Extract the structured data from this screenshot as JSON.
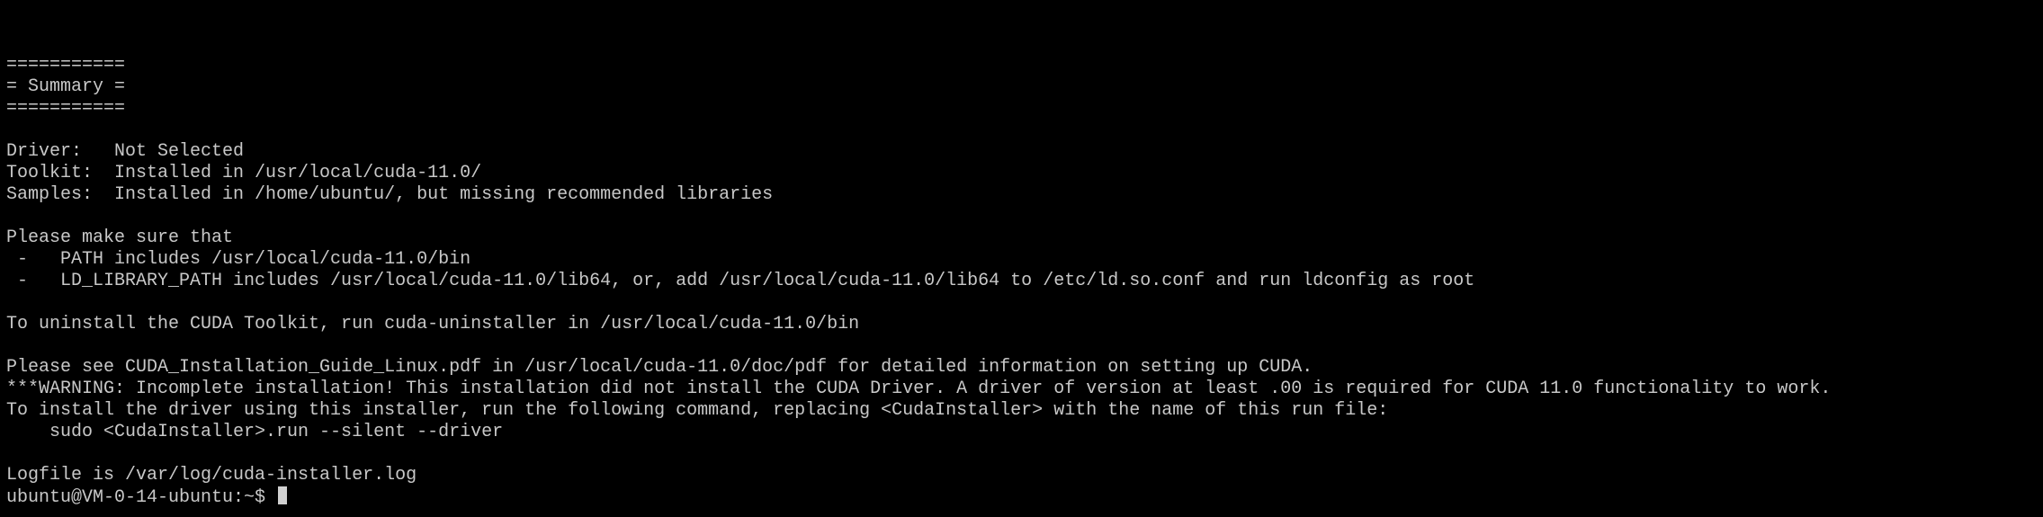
{
  "terminal": {
    "lines": [
      "===========",
      "= Summary =",
      "===========",
      "",
      "Driver:   Not Selected",
      "Toolkit:  Installed in /usr/local/cuda-11.0/",
      "Samples:  Installed in /home/ubuntu/, but missing recommended libraries",
      "",
      "Please make sure that",
      " -   PATH includes /usr/local/cuda-11.0/bin",
      " -   LD_LIBRARY_PATH includes /usr/local/cuda-11.0/lib64, or, add /usr/local/cuda-11.0/lib64 to /etc/ld.so.conf and run ldconfig as root",
      "",
      "To uninstall the CUDA Toolkit, run cuda-uninstaller in /usr/local/cuda-11.0/bin",
      "",
      "Please see CUDA_Installation_Guide_Linux.pdf in /usr/local/cuda-11.0/doc/pdf for detailed information on setting up CUDA.",
      "***WARNING: Incomplete installation! This installation did not install the CUDA Driver. A driver of version at least .00 is required for CUDA 11.0 functionality to work.",
      "To install the driver using this installer, run the following command, replacing <CudaInstaller> with the name of this run file:",
      "    sudo <CudaInstaller>.run --silent --driver",
      "",
      "Logfile is /var/log/cuda-installer.log"
    ],
    "prompt": "ubuntu@VM-0-14-ubuntu:~$ ",
    "colors": {
      "background": "#000000",
      "foreground": "#c8c8c8",
      "cursor": "#d0d0d0"
    }
  }
}
